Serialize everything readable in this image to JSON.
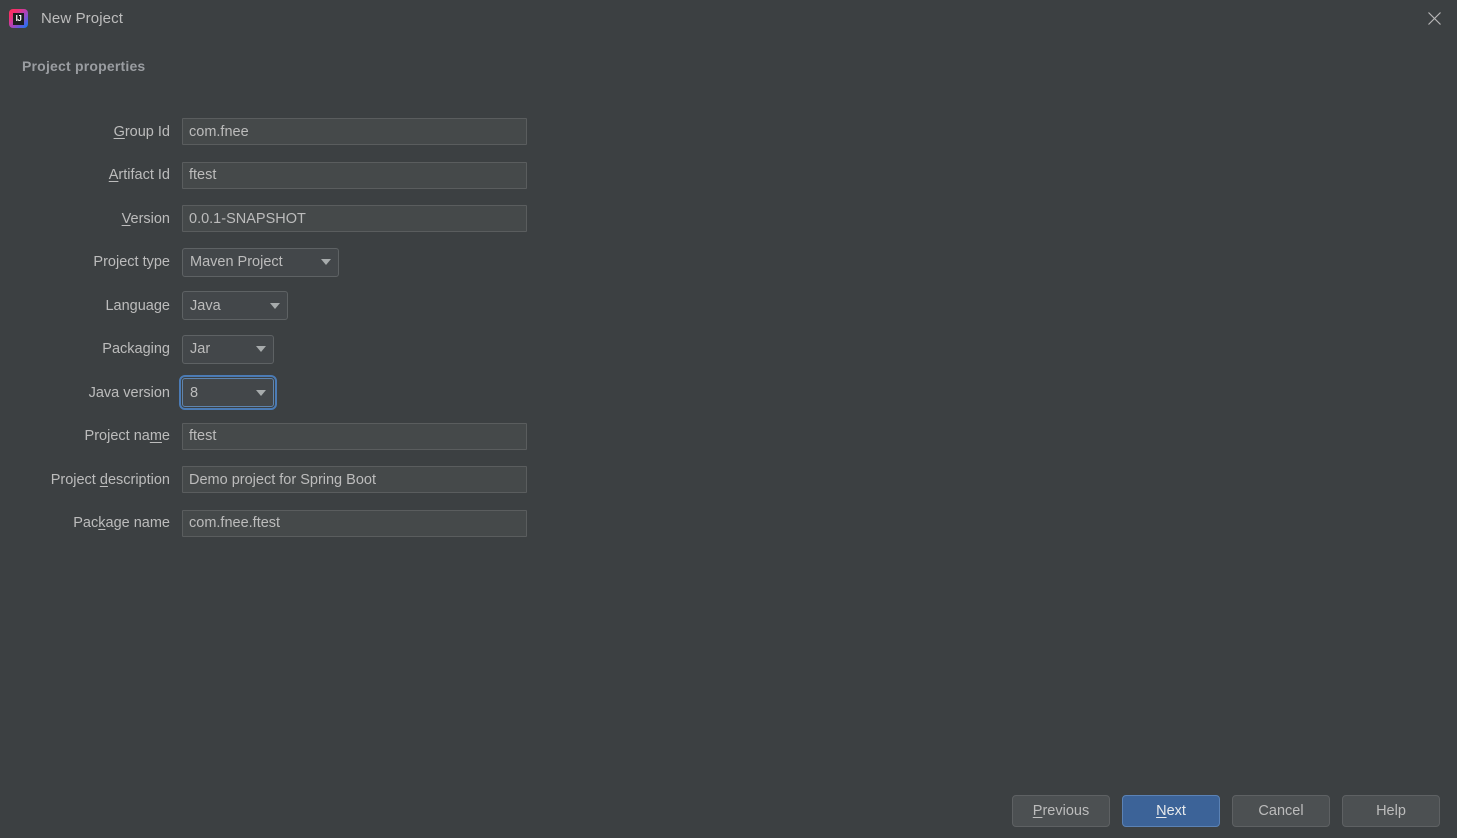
{
  "window": {
    "title": "New Project",
    "app_icon": "intellij-idea-logo",
    "close_icon": "close-icon"
  },
  "section": {
    "title": "Project properties"
  },
  "form": {
    "fields": [
      {
        "label_pre": "",
        "label_mnemonic": "G",
        "label_post": "roup Id",
        "type": "text",
        "value": "com.fnee",
        "name": "group-id"
      },
      {
        "label_pre": "",
        "label_mnemonic": "A",
        "label_post": "rtifact Id",
        "type": "text",
        "value": "ftest",
        "name": "artifact-id"
      },
      {
        "label_pre": "",
        "label_mnemonic": "V",
        "label_post": "ersion",
        "type": "text",
        "value": "0.0.1-SNAPSHOT",
        "name": "version"
      },
      {
        "label_pre": "Project type",
        "label_mnemonic": "",
        "label_post": "",
        "type": "combo",
        "value": "Maven Project",
        "name": "project-type",
        "width": "w-projecttype"
      },
      {
        "label_pre": "Language",
        "label_mnemonic": "",
        "label_post": "",
        "type": "combo",
        "value": "Java",
        "name": "language",
        "width": "w-language"
      },
      {
        "label_pre": "Packaging",
        "label_mnemonic": "",
        "label_post": "",
        "type": "combo",
        "value": "Jar",
        "name": "packaging",
        "width": "w-packaging"
      },
      {
        "label_pre": "Java version",
        "label_mnemonic": "",
        "label_post": "",
        "type": "combo",
        "value": "8",
        "name": "java-version",
        "width": "w-javaversion",
        "focused": true
      },
      {
        "label_pre": "Project na",
        "label_mnemonic": "m",
        "label_post": "e",
        "type": "text",
        "value": "ftest",
        "name": "project-name"
      },
      {
        "label_pre": "Project ",
        "label_mnemonic": "d",
        "label_post": "escription",
        "type": "text",
        "value": "Demo project for Spring Boot",
        "name": "project-description"
      },
      {
        "label_pre": "Pac",
        "label_mnemonic": "k",
        "label_post": "age name",
        "type": "text",
        "value": "com.fnee.ftest",
        "name": "package-name"
      }
    ]
  },
  "buttons": [
    {
      "pre": "",
      "mnemonic": "P",
      "post": "revious",
      "name": "previous-button",
      "primary": false
    },
    {
      "pre": "",
      "mnemonic": "N",
      "post": "ext",
      "name": "next-button",
      "primary": true
    },
    {
      "pre": "Cancel",
      "mnemonic": "",
      "post": "",
      "name": "cancel-button",
      "primary": false
    },
    {
      "pre": "Help",
      "mnemonic": "",
      "post": "",
      "name": "help-button",
      "primary": false
    }
  ],
  "colors": {
    "background": "#3c4042",
    "accent": "#3c6398",
    "focus_ring": "#4b7bb5",
    "text": "#bcbcbc",
    "section_header": "#9a9da1"
  }
}
